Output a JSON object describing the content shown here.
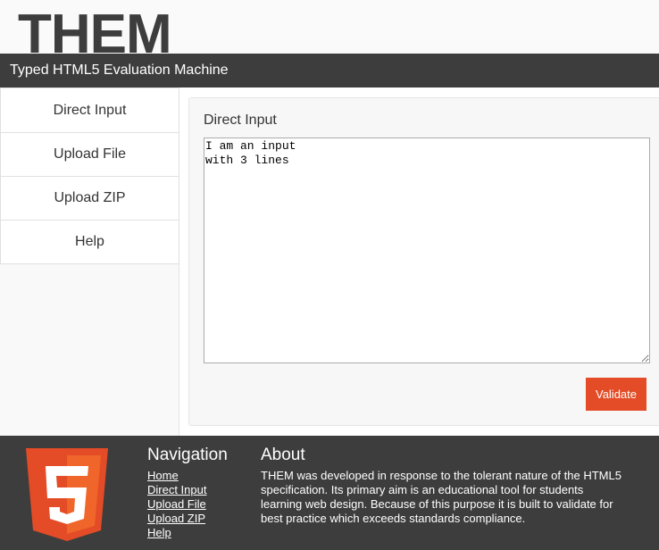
{
  "header": {
    "logo_text": "THEM",
    "subtitle": "Typed HTML5 Evaluation Machine"
  },
  "sidebar": {
    "items": [
      {
        "label": "Direct Input"
      },
      {
        "label": "Upload File"
      },
      {
        "label": "Upload ZIP"
      },
      {
        "label": "Help"
      }
    ]
  },
  "main": {
    "panel_title": "Direct Input",
    "textarea_value": "I am an input\nwith 3 lines",
    "validate_label": "Validate"
  },
  "footer": {
    "logo_icon": "html5-logo-icon",
    "logo_digit": "5",
    "nav_title": "Navigation",
    "nav_links": [
      "Home",
      "Direct Input",
      "Upload File",
      "Upload ZIP",
      "Help"
    ],
    "about_title": "About",
    "about_text": "THEM was developed in response to the tolerant nature of the HTML5 specification. Its primary aim is an educational tool for students learning web design. Because of this purpose it is built to validate for best practice which exceeds standards compliance."
  },
  "colors": {
    "accent": "#e34c26",
    "dark": "#3d3d3d",
    "panel_bg": "#f7f7f7"
  }
}
